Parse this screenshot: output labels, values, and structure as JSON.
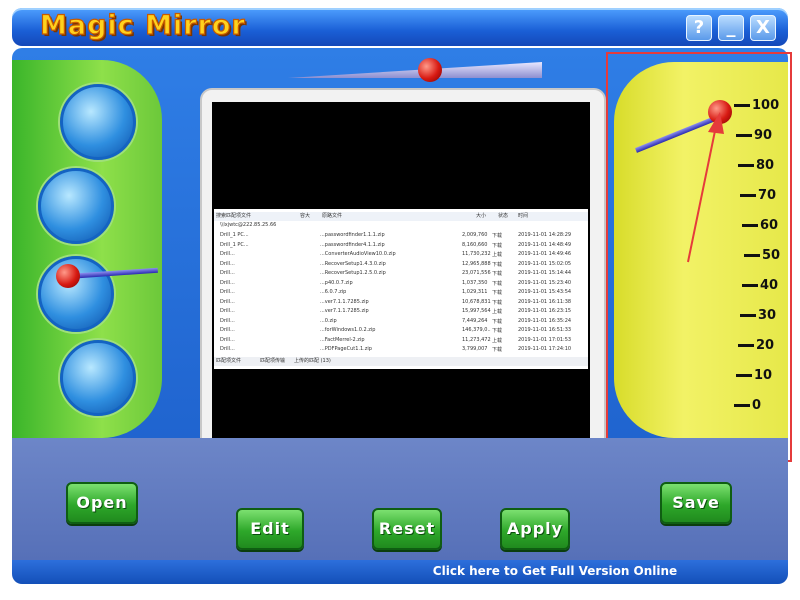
{
  "window": {
    "title": "Magic Mirror",
    "help_label": "?",
    "minimize_label": "_",
    "close_label": "X"
  },
  "preview": {
    "header": [
      "搜索匹配项文件",
      "容大",
      "原路文件",
      "大小",
      "状态",
      "时间"
    ],
    "path_row": "\\\\lxjwtc@222.85.25.66",
    "rows": [
      [
        "Drill_1 PC...",
        "...passwordfinder1.1.1.zip",
        "2,009,760",
        "下载",
        "2019-11-01 14:28:29"
      ],
      [
        "Drill_1 PC...",
        "...passwordfinder4.1.1.zip",
        "8,160,660",
        "下载",
        "2019-11-01 14:48:49"
      ],
      [
        "Drill...",
        "...ConverterAudioView10.0.zip",
        "11,730,232",
        "上载",
        "2019-11-01 14:49:46"
      ],
      [
        "Drill...",
        "...RecoverSetup1.4.3.0.zip",
        "12,965,888",
        "下载",
        "2019-11-01 15:02:05"
      ],
      [
        "Drill...",
        "...RecoverSetup1.2.5.0.zip",
        "23,071,556",
        "下载",
        "2019-11-01 15:14:44"
      ],
      [
        "Drill...",
        "...p40.0.7.zip",
        "1,037,350",
        "下载",
        "2019-11-01 15:23:40"
      ],
      [
        "Drill...",
        "...6.0.7.zip",
        "1,029,311",
        "下载",
        "2019-11-01 15:43:54"
      ],
      [
        "Drill...",
        "...ver7.1.1.7285.zip",
        "10,678,831",
        "下载",
        "2019-11-01 16:11:38"
      ],
      [
        "Drill...",
        "...ver7.1.1.7285.zip",
        "15,997,564",
        "上载",
        "2019-11-01 16:23:15"
      ],
      [
        "Drill...",
        "...0.zip",
        "7,449,264",
        "下载",
        "2019-11-01 16:35:24"
      ],
      [
        "Drill...",
        "...forWindows1.0.2.zip",
        "146,379,0..",
        "下载",
        "2019-11-01 16:51:33"
      ],
      [
        "Drill...",
        "...FactMerrel-2.zip",
        "11,273,472",
        "上载",
        "2019-11-01 17:01:53"
      ],
      [
        "Drill...",
        "...PDFPageCut1.1.zip",
        "3,799,007",
        "下载",
        "2019-11-01 17:24:10"
      ]
    ],
    "tabs": [
      "匹配项文件",
      "匹配项传输",
      "上传的匹配 (13)"
    ]
  },
  "gauge": {
    "labels": [
      "100",
      "90",
      "80",
      "70",
      "60",
      "50",
      "40",
      "30",
      "20",
      "10",
      "0"
    ],
    "value": 100
  },
  "buttons": {
    "open": "Open",
    "edit": "Edit",
    "reset": "Reset",
    "apply": "Apply",
    "save": "Save"
  },
  "footer": {
    "link": "Click here to Get Full Version Online"
  },
  "colors": {
    "title_yellow": "#ffd21e",
    "frame_blue": "#1b5cc8",
    "left_green": "#6cc83a",
    "right_yellow": "#f2f266",
    "button_green": "#2ea82a",
    "highlight_red": "#e53b3b"
  }
}
